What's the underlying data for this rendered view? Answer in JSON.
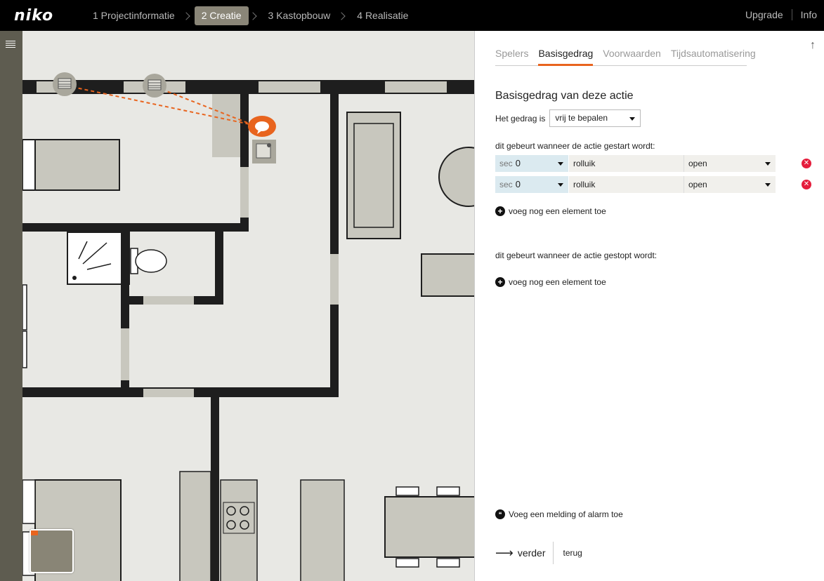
{
  "header": {
    "logo": "niko",
    "steps": [
      {
        "label": "1 Projectinformatie",
        "active": false
      },
      {
        "label": "2 Creatie",
        "active": true
      },
      {
        "label": "3 Kastopbouw",
        "active": false
      },
      {
        "label": "4 Realisatie",
        "active": false
      }
    ],
    "upgrade": "Upgrade",
    "info": "Info"
  },
  "sidebar": {
    "menu_icon": "list-icon"
  },
  "panel": {
    "up_icon": "↑",
    "tabs": [
      "Spelers",
      "Basisgedrag",
      "Voorwaarden",
      "Tijdsautomatisering"
    ],
    "active_tab": "Basisgedrag",
    "title": "Basisgedrag van deze actie",
    "behavior_label": "Het gedrag is",
    "behavior_value": "vrij te bepalen",
    "started_label": "dit gebeurt wanneer de actie gestart wordt:",
    "started_actions": [
      {
        "unit": "sec",
        "delay": "0",
        "element": "rolluik",
        "state": "open"
      },
      {
        "unit": "sec",
        "delay": "0",
        "element": "rolluik",
        "state": "open"
      }
    ],
    "add_element": "voeg nog een element toe",
    "stopped_label": "dit gebeurt wanneer de actie gestopt wordt:",
    "add_element_stopped": "voeg nog een element toe",
    "alarm": "Voeg een melding of alarm toe",
    "next": "verder",
    "back": "terug"
  },
  "colors": {
    "accent": "#e8641e",
    "step_active_bg": "#8a8678",
    "delay_cell_bg": "#dbeaf0",
    "remove_red": "#e51d3c",
    "wall": "#1e1e1e",
    "floor": "#e8e8e4",
    "furniture": "#c8c7be"
  }
}
